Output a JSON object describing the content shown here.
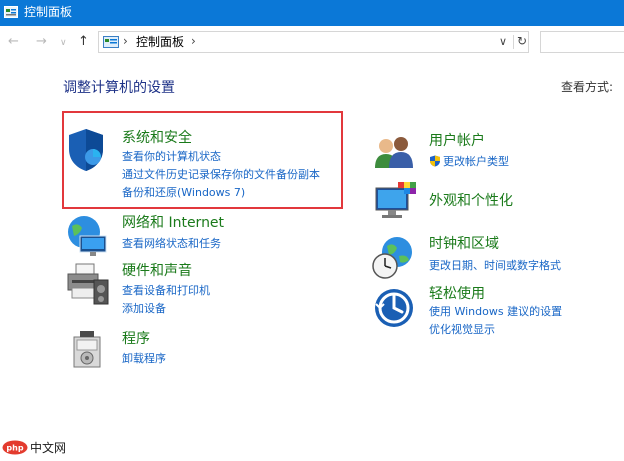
{
  "window": {
    "title": "控制面板"
  },
  "nav": {
    "back_icon": "arrow-left-icon",
    "forward_icon": "arrow-right-icon",
    "recent_icon": "chevron-down-icon",
    "up_icon": "arrow-up-icon",
    "address_crumb": "控制面板",
    "address_sep": "›",
    "refresh_icon": "refresh-icon",
    "search_placeholder": ""
  },
  "main": {
    "heading": "调整计算机的设置",
    "view_by_label": "查看方式:"
  },
  "categories_left": [
    {
      "title": "系统和安全",
      "icon": "shield-icon",
      "links": [
        "查看你的计算机状态",
        "通过文件历史记录保存你的文件备份副本",
        "备份和还原(Windows 7)"
      ]
    },
    {
      "title": "网络和 Internet",
      "icon": "network-globe-icon",
      "links": [
        "查看网络状态和任务"
      ]
    },
    {
      "title": "硬件和声音",
      "icon": "printer-speaker-icon",
      "links": [
        "查看设备和打印机",
        "添加设备"
      ]
    },
    {
      "title": "程序",
      "icon": "programs-icon",
      "links": [
        "卸载程序"
      ]
    }
  ],
  "categories_right": [
    {
      "title": "用户帐户",
      "icon": "users-icon",
      "links": [
        "更改帐户类型"
      ]
    },
    {
      "title": "外观和个性化",
      "icon": "monitor-palette-icon",
      "links": []
    },
    {
      "title": "时钟和区域",
      "icon": "clock-globe-icon",
      "links": [
        "更改日期、时间或数字格式"
      ]
    },
    {
      "title": "轻松使用",
      "icon": "ease-of-access-icon",
      "links": [
        "使用 Windows 建议的设置",
        "优化视觉显示"
      ]
    }
  ],
  "watermark": {
    "logo": "php",
    "text": "中文网"
  },
  "colors": {
    "titlebar": "#0b78d7",
    "category_title": "#1a7a1a",
    "link": "#1866c6",
    "heading": "#1e3287",
    "highlight": "#e2383c"
  }
}
